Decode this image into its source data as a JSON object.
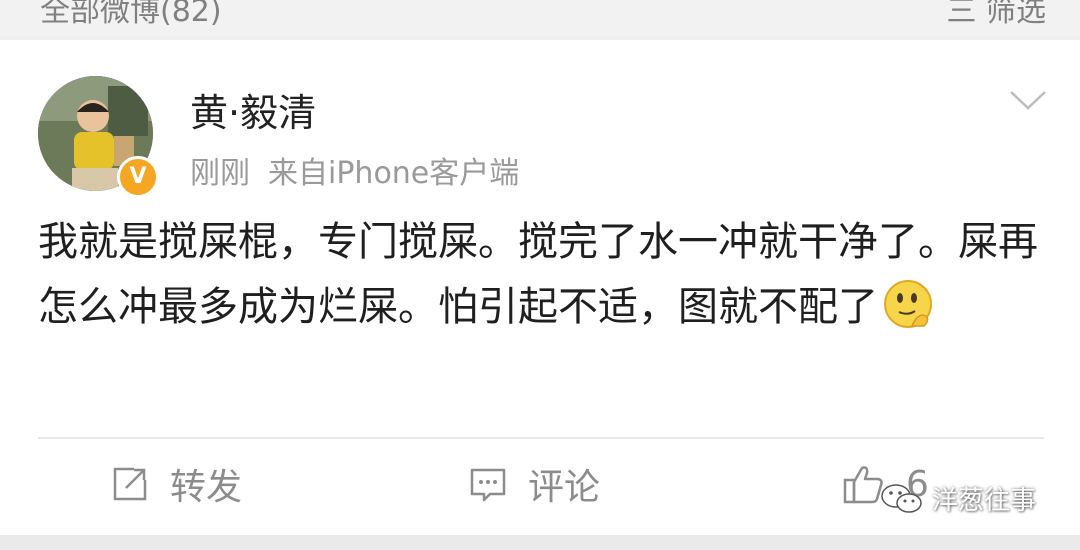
{
  "top_bar": {
    "left_text": "全部微博(82)",
    "right_text": "三 筛选"
  },
  "post": {
    "username": "黄·毅清",
    "time": "刚刚",
    "source": "来自iPhone客户端",
    "verified_badge": "V",
    "text": "我就是搅屎棍，专门搅屎。搅完了水一冲就干净了。屎再怎么冲最多成为烂屎。怕引起不适，图就不配了",
    "emoji": "thinking-smiley-icon"
  },
  "actions": {
    "forward_label": "转发",
    "comment_label": "评论",
    "like_count": "6"
  },
  "watermark": {
    "text": "洋葱往事",
    "icon": "wechat-icon"
  },
  "colors": {
    "verified": "#f5a623",
    "text": "#1f1f1f",
    "muted": "#9a9a9a",
    "background": "#efefef"
  }
}
